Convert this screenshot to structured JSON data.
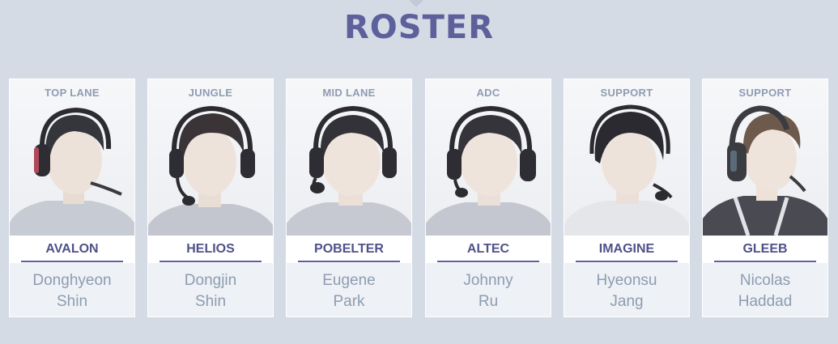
{
  "header": {
    "title": "ROSTER"
  },
  "colors": {
    "background": "#d4dbe5",
    "accent": "#5d609b",
    "role_text": "#8f9cb1",
    "name_text": "#8d9db1"
  },
  "players": [
    {
      "role": "TOP LANE",
      "nickname": "AVALON",
      "first_name": "Donghyeon",
      "last_name": "Shin",
      "icon": "player-portrait"
    },
    {
      "role": "JUNGLE",
      "nickname": "HELIOS",
      "first_name": "Dongjin",
      "last_name": "Shin",
      "icon": "player-portrait"
    },
    {
      "role": "MID LANE",
      "nickname": "POBELTER",
      "first_name": "Eugene",
      "last_name": "Park",
      "icon": "player-portrait"
    },
    {
      "role": "ADC",
      "nickname": "ALTEC",
      "first_name": "Johnny",
      "last_name": "Ru",
      "icon": "player-portrait"
    },
    {
      "role": "SUPPORT",
      "nickname": "IMAGINE",
      "first_name": "Hyeonsu",
      "last_name": "Jang",
      "icon": "player-portrait"
    },
    {
      "role": "SUPPORT",
      "nickname": "GLEEB",
      "first_name": "Nicolas",
      "last_name": "Haddad",
      "icon": "player-portrait"
    }
  ]
}
